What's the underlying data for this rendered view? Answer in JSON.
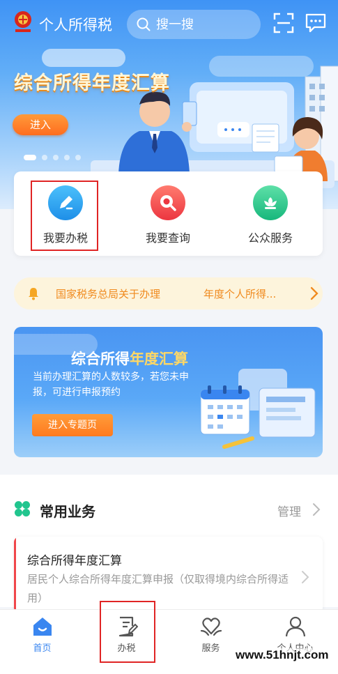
{
  "header": {
    "app_title": "个人所得税",
    "search_placeholder": "搜一搜"
  },
  "banner": {
    "title": "综合所得年度汇算",
    "enter_label": "进入",
    "slide_count": 5,
    "active_slide": 1
  },
  "quick_actions": [
    {
      "label": "我要办税",
      "icon": "pen-icon",
      "color": "#2aa3f0"
    },
    {
      "label": "我要查询",
      "icon": "search-icon",
      "color": "#f04d52"
    },
    {
      "label": "公众服务",
      "icon": "flower-icon",
      "color": "#23c48b"
    }
  ],
  "notice": {
    "text_1": "国家税务总局关于办理",
    "text_2": "年度个人所得..."
  },
  "promo": {
    "title_plain": "综合所得",
    "title_highlight": "年度汇算",
    "description": "当前办理汇算的人数较多，若您未申报，可进行申报预约",
    "button_label": "进入专题页"
  },
  "common_services": {
    "title": "常用业务",
    "manage_label": "管理",
    "items": [
      {
        "title": "综合所得年度汇算",
        "description": "居民个人综合所得年度汇算申报（仅取得境内综合所得适用）"
      }
    ]
  },
  "tabbar": {
    "tabs": [
      {
        "label": "首页",
        "active": true
      },
      {
        "label": "办税",
        "active": false
      },
      {
        "label": "服务",
        "active": false
      },
      {
        "label": "个人中心",
        "active": false
      }
    ]
  },
  "watermark": "www.51hnjt.com",
  "colors": {
    "brand_blue": "#3a86f0",
    "orange": "#ff7a1f",
    "highlight_red": "#e02424"
  }
}
